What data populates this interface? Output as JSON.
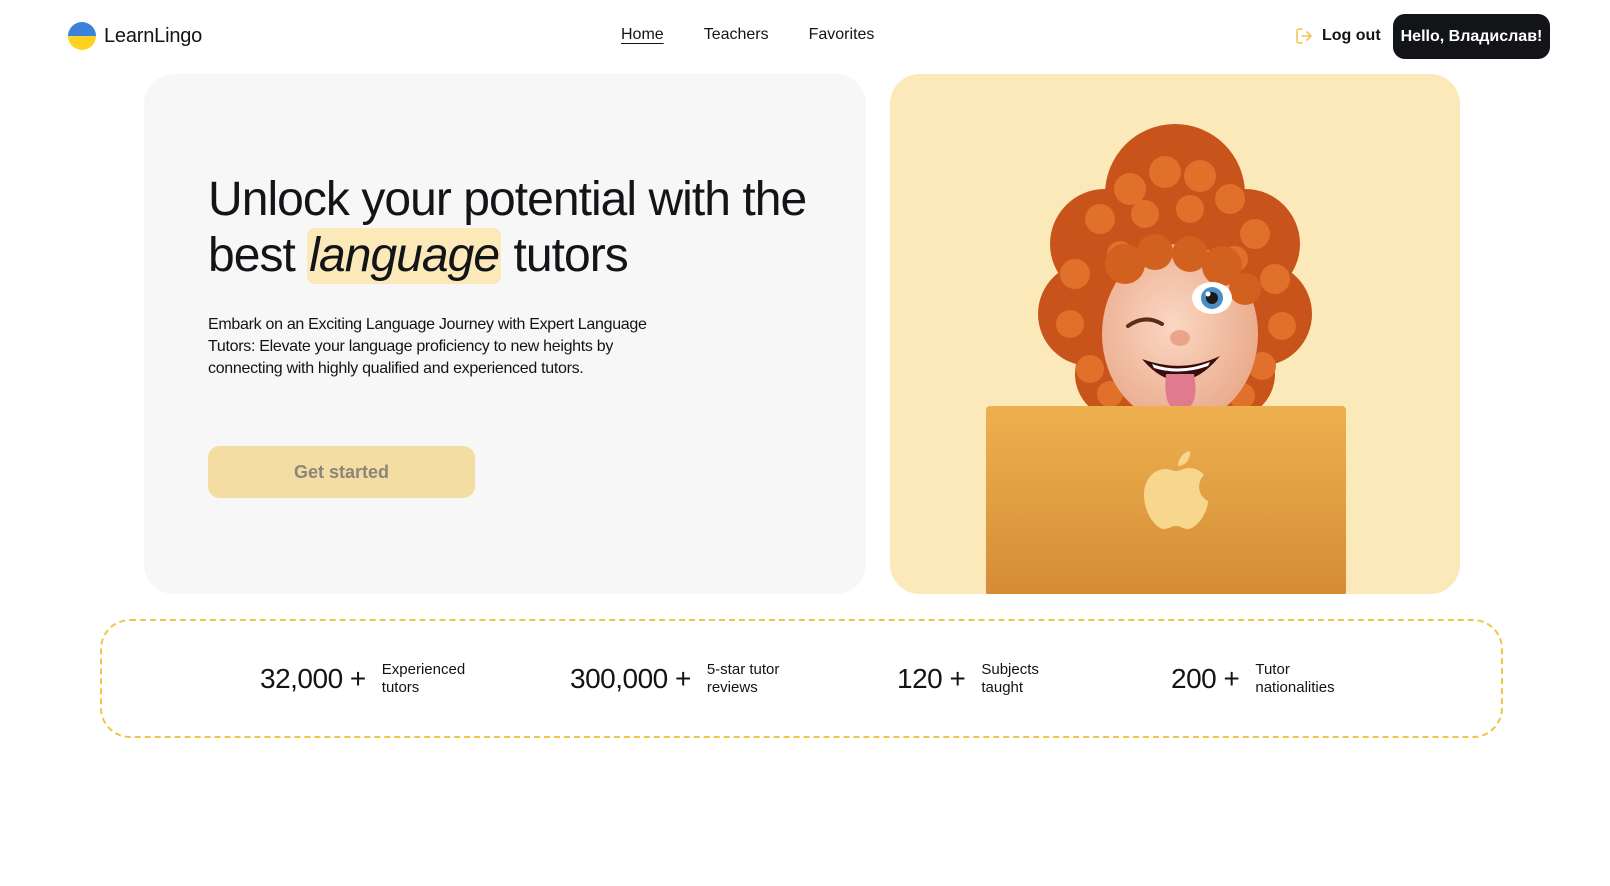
{
  "header": {
    "logo_text": "LearnLingo",
    "nav": [
      {
        "label": "Home"
      },
      {
        "label": "Teachers"
      },
      {
        "label": "Favorites"
      }
    ],
    "logout_label": "Log out",
    "greeting": "Hello, Владислав!"
  },
  "hero": {
    "title_part1": "Unlock your potential with the best ",
    "title_highlight": "language",
    "title_part2": " tutors",
    "description": "Embark on an Exciting Language Journey with Expert Language Tutors: Elevate your language proficiency to new heights by connecting with highly qualified and experienced tutors.",
    "cta_label": "Get started"
  },
  "stats": [
    {
      "value": "32,000 +",
      "label": "Experienced tutors"
    },
    {
      "value": "300,000 +",
      "label": "5-star tutor reviews"
    },
    {
      "value": "120 +",
      "label": "Subjects taught"
    },
    {
      "value": "200 +",
      "label": "Tutor nationalities"
    }
  ],
  "colors": {
    "accent": "#f4c550",
    "accent_light": "#fbe9ba",
    "cta_bg": "#f4dda3",
    "dark": "#121417",
    "panel_bg": "#f7f7f7",
    "logo_blue": "#3b82dd",
    "logo_yellow": "#ffd21f"
  }
}
